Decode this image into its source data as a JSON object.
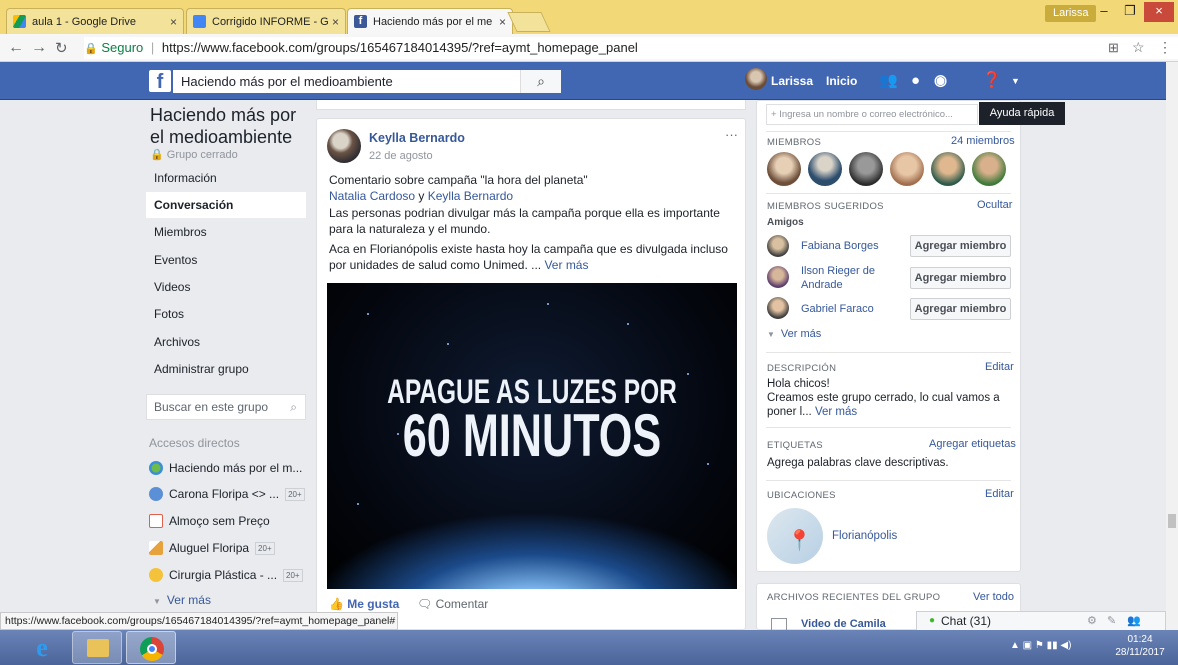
{
  "browser": {
    "tabs": [
      {
        "label": "aula 1 - Google Drive",
        "close": "×"
      },
      {
        "label": "Corrigido INFORME - Go",
        "close": "×"
      },
      {
        "label": "Haciendo más por el me",
        "close": "×"
      }
    ],
    "user_badge": "Larissa",
    "window_controls": {
      "minimize": "–",
      "maximize": "❐",
      "close": "×"
    },
    "secure_label": "Seguro",
    "url": "https://www.facebook.com/groups/165467184014395/?ref=aymt_homepage_panel",
    "status_link": "https://www.facebook.com/groups/165467184014395/?ref=aymt_homepage_panel#"
  },
  "fb_header": {
    "logo": "f",
    "search_value": "Haciendo más por el medioambiente",
    "user_name": "Larissa",
    "home_label": "Inicio"
  },
  "tooltip": "Ayuda rápida",
  "left_nav": {
    "group_name": "Haciendo más por el medioambiente",
    "group_type": "Grupo cerrado",
    "items": [
      {
        "label": "Información"
      },
      {
        "label": "Conversación"
      },
      {
        "label": "Miembros"
      },
      {
        "label": "Eventos"
      },
      {
        "label": "Videos"
      },
      {
        "label": "Fotos"
      },
      {
        "label": "Archivos"
      },
      {
        "label": "Administrar grupo"
      }
    ],
    "search_placeholder": "Buscar en este grupo",
    "shortcuts_title": "Accesos directos",
    "shortcuts": [
      {
        "label": "Haciendo más por el m...",
        "badge": ""
      },
      {
        "label": "Carona Floripa <> ...",
        "badge": "20+"
      },
      {
        "label": "Almoço sem Preço",
        "badge": ""
      },
      {
        "label": "Aluguel Floripa",
        "badge": "20+"
      },
      {
        "label": "Cirurgia Plástica - ...",
        "badge": "20+"
      }
    ],
    "see_more": "Ver más"
  },
  "post": {
    "author": "Keylla Bernardo",
    "date": "22 de agosto",
    "menu": "···",
    "line1": "Comentario sobre campaña \"la hora del planeta\"",
    "tag1": "Natalia Cardoso",
    "tag_and": " y ",
    "tag2": "Keylla Bernardo",
    "line2": "Las personas podrian divulgar más la campaña porque ella es importante para la naturaleza y el mundo.",
    "line3": "Aca en Florianópolis existe hasta hoy la campaña que es divulgada incluso por unidades de salud como Unimed. ...",
    "see_more": "Ver más",
    "image_text_1": "APAGUE AS LUZES POR",
    "image_text_2": "60 MINUTOS",
    "like_label": "Me gusta",
    "comment_label": "Comentar"
  },
  "right": {
    "invite_placeholder": "+ Ingresa un nombre o correo electrónico...",
    "members_title": "MIEMBROS",
    "members_count": "24 miembros",
    "suggested_title": "MIEMBROS SUGERIDOS",
    "hide_label": "Ocultar",
    "friends_label": "Amigos",
    "suggested": [
      {
        "name": "Fabiana Borges",
        "button": "Agregar miembro"
      },
      {
        "name": "Ilson Rieger de Andrade",
        "button": "Agregar miembro"
      },
      {
        "name": "Gabriel Faraco",
        "button": "Agregar miembro"
      }
    ],
    "see_more": "Ver más",
    "description_title": "DESCRIPCIÓN",
    "edit_label": "Editar",
    "description_1": "Hola chicos!",
    "description_2": "Creamos este grupo cerrado, lo cual vamos a poner l...",
    "description_more": "Ver más",
    "tags_title": "ETIQUETAS",
    "tags_action": "Agregar etiquetas",
    "tags_text": "Agrega palabras clave descriptivas.",
    "locations_title": "UBICACIONES",
    "locations_edit": "Editar",
    "location_name": "Florianópolis",
    "files_title": "ARCHIVOS RECIENTES DEL GRUPO",
    "files_action": "Ver todo",
    "file_name": "Video de Camila"
  },
  "chat": {
    "label": "Chat (31)"
  },
  "taskbar": {
    "time": "01:24",
    "date": "28/11/2017"
  },
  "colors": {
    "fb_blue": "#4267b2",
    "link": "#365899",
    "chrome_tab": "#f2d877"
  }
}
